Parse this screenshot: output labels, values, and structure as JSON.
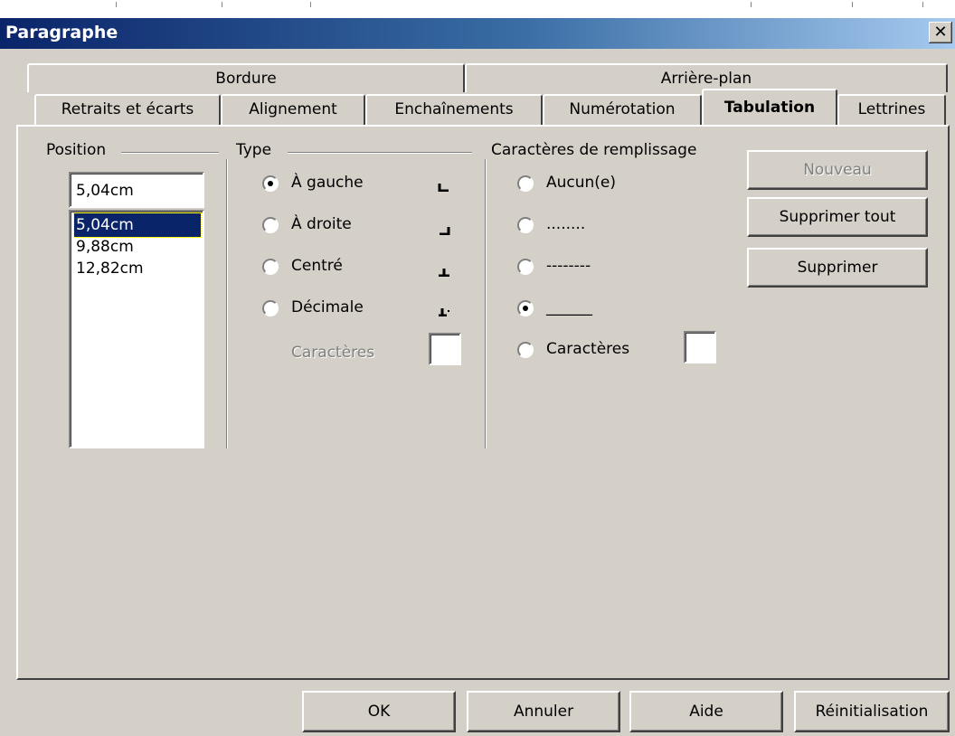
{
  "window": {
    "title": "Paragraphe",
    "close_glyph": "✕"
  },
  "tabs_back": [
    {
      "label": "Bordure"
    },
    {
      "label": "Arrière-plan"
    }
  ],
  "tabs_front": [
    {
      "label": "Retraits et écarts"
    },
    {
      "label": "Alignement"
    },
    {
      "label": "Enchaînements"
    },
    {
      "label": "Numérotation"
    },
    {
      "label": "Tabulation",
      "active": true
    },
    {
      "label": "Lettrines"
    }
  ],
  "position": {
    "group_label": "Position",
    "input_value": "5,04cm",
    "items": [
      "5,04cm",
      "9,88cm",
      "12,82cm"
    ],
    "selected": "5,04cm"
  },
  "type": {
    "group_label": "Type",
    "options": [
      {
        "label": "À gauche",
        "checked": true,
        "icon": "tab-left-icon"
      },
      {
        "label": "À droite",
        "checked": false,
        "icon": "tab-right-icon"
      },
      {
        "label": "Centré",
        "checked": false,
        "icon": "tab-center-icon"
      },
      {
        "label": "Décimale",
        "checked": false,
        "icon": "tab-decimal-icon"
      }
    ],
    "chars_label": "Caractères",
    "chars_value": ""
  },
  "fill": {
    "group_label": "Caractères de remplissage",
    "options": [
      {
        "label": "Aucun(e)",
        "checked": false
      },
      {
        "label": "........",
        "checked": false
      },
      {
        "label": "--------",
        "checked": false
      },
      {
        "label": "______",
        "checked": true
      },
      {
        "label": "Caractères",
        "checked": false
      }
    ],
    "chars_value": ""
  },
  "side_buttons": {
    "new": "Nouveau",
    "delete_all": "Supprimer tout",
    "delete": "Supprimer"
  },
  "footer": {
    "ok": "OK",
    "cancel": "Annuler",
    "help": "Aide",
    "reset": "Réinitialisation"
  }
}
